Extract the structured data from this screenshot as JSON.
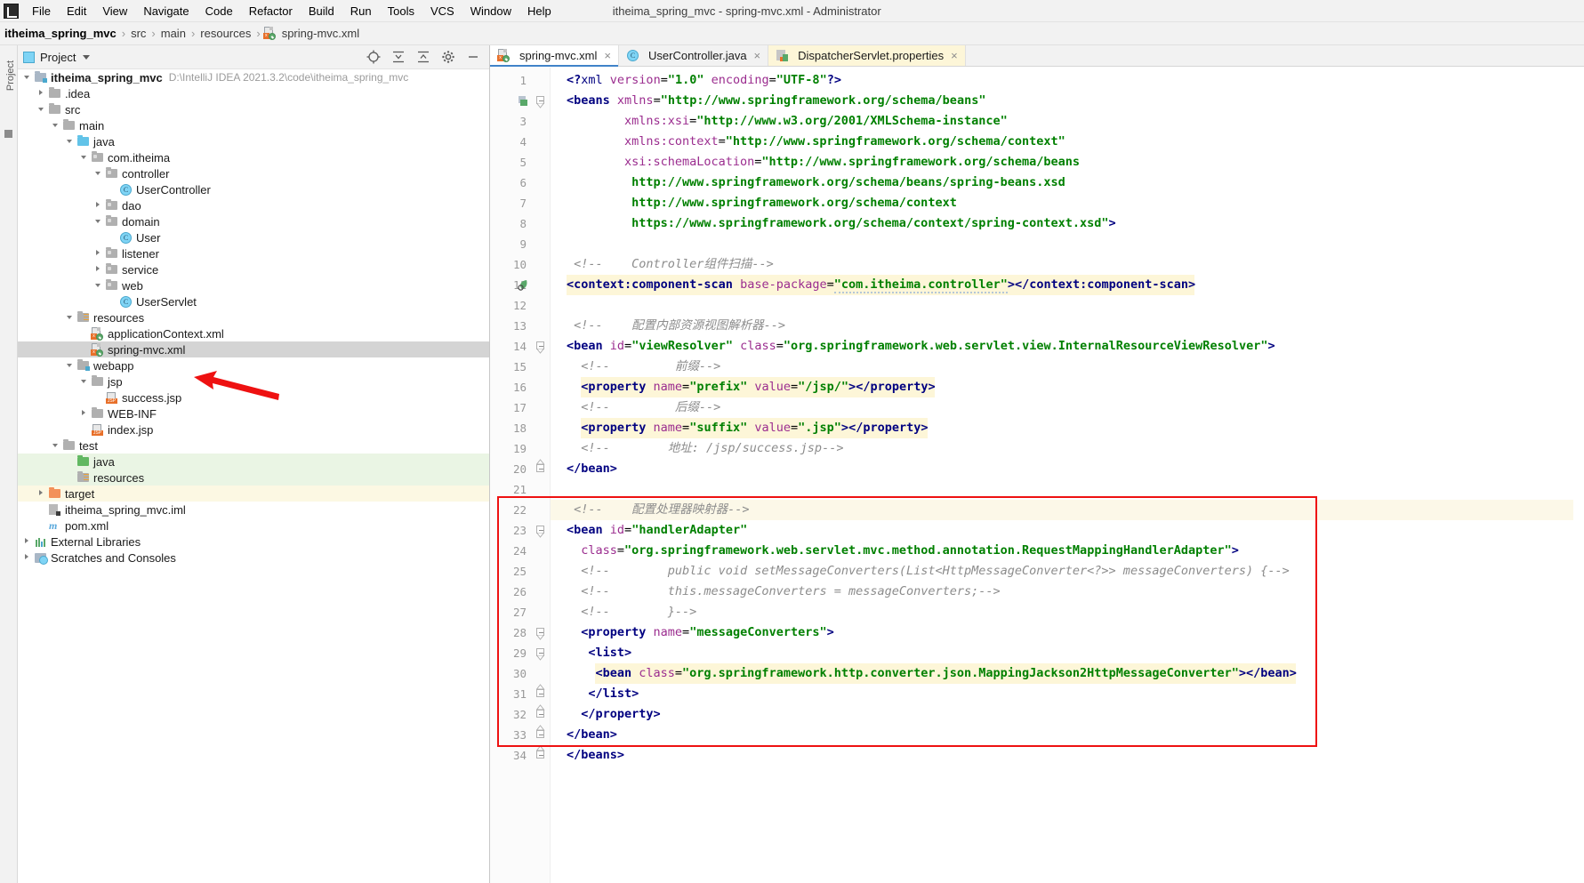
{
  "window": {
    "title": "itheima_spring_mvc - spring-mvc.xml - Administrator"
  },
  "menubar": {
    "items": [
      "File",
      "Edit",
      "View",
      "Navigate",
      "Code",
      "Refactor",
      "Build",
      "Run",
      "Tools",
      "VCS",
      "Window",
      "Help"
    ]
  },
  "breadcrumb": {
    "items": [
      "itheima_spring_mvc",
      "src",
      "main",
      "resources",
      "spring-mvc.xml"
    ],
    "separator": "›"
  },
  "toolstrip": {
    "project_label": "Project"
  },
  "project_panel": {
    "title": "Project",
    "tree": [
      {
        "depth": 0,
        "arrow": "down",
        "icon": "module-folder",
        "label": "itheima_spring_mvc",
        "bold": true,
        "path": "D:\\IntelliJ IDEA 2021.3.2\\code\\itheima_spring_mvc"
      },
      {
        "depth": 1,
        "arrow": "right",
        "icon": "folder-gray",
        "label": ".idea"
      },
      {
        "depth": 1,
        "arrow": "down",
        "icon": "folder-gray",
        "label": "src"
      },
      {
        "depth": 2,
        "arrow": "down",
        "icon": "folder-gray",
        "label": "main"
      },
      {
        "depth": 3,
        "arrow": "down",
        "icon": "folder-blue",
        "label": "java"
      },
      {
        "depth": 4,
        "arrow": "down",
        "icon": "package",
        "label": "com.itheima"
      },
      {
        "depth": 5,
        "arrow": "down",
        "icon": "package",
        "label": "controller"
      },
      {
        "depth": 6,
        "arrow": "none",
        "icon": "class",
        "label": "UserController"
      },
      {
        "depth": 5,
        "arrow": "right",
        "icon": "package",
        "label": "dao"
      },
      {
        "depth": 5,
        "arrow": "down",
        "icon": "package",
        "label": "domain"
      },
      {
        "depth": 6,
        "arrow": "none",
        "icon": "class",
        "label": "User"
      },
      {
        "depth": 5,
        "arrow": "right",
        "icon": "package",
        "label": "listener"
      },
      {
        "depth": 5,
        "arrow": "right",
        "icon": "package",
        "label": "service"
      },
      {
        "depth": 5,
        "arrow": "down",
        "icon": "package",
        "label": "web"
      },
      {
        "depth": 6,
        "arrow": "none",
        "icon": "class",
        "label": "UserServlet"
      },
      {
        "depth": 3,
        "arrow": "down",
        "icon": "folder-resources",
        "label": "resources"
      },
      {
        "depth": 4,
        "arrow": "none",
        "icon": "xml",
        "label": "applicationContext.xml"
      },
      {
        "depth": 4,
        "arrow": "none",
        "icon": "xml",
        "label": "spring-mvc.xml",
        "selected": true
      },
      {
        "depth": 3,
        "arrow": "down",
        "icon": "folder-webapp",
        "label": "webapp"
      },
      {
        "depth": 4,
        "arrow": "down",
        "icon": "folder-gray",
        "label": "jsp"
      },
      {
        "depth": 5,
        "arrow": "none",
        "icon": "jsp",
        "label": "success.jsp"
      },
      {
        "depth": 4,
        "arrow": "right",
        "icon": "folder-gray",
        "label": "WEB-INF"
      },
      {
        "depth": 4,
        "arrow": "none",
        "icon": "jsp",
        "label": "index.jsp"
      },
      {
        "depth": 2,
        "arrow": "down",
        "icon": "folder-gray",
        "label": "test"
      },
      {
        "depth": 3,
        "arrow": "none",
        "icon": "folder-green",
        "label": "java",
        "bg": "green"
      },
      {
        "depth": 3,
        "arrow": "none",
        "icon": "folder-test-resources",
        "label": "resources",
        "bg": "green"
      },
      {
        "depth": 1,
        "arrow": "right",
        "icon": "folder-orange",
        "label": "target",
        "bg": "yellow"
      },
      {
        "depth": 1,
        "arrow": "none",
        "icon": "iml",
        "label": "itheima_spring_mvc.iml"
      },
      {
        "depth": 1,
        "arrow": "none",
        "icon": "maven",
        "label": "pom.xml"
      },
      {
        "depth": 0,
        "arrow": "right",
        "icon": "libraries",
        "label": "External Libraries"
      },
      {
        "depth": 0,
        "arrow": "right",
        "icon": "scratches",
        "label": "Scratches and Consoles"
      }
    ]
  },
  "editor": {
    "tabs": [
      {
        "label": "spring-mvc.xml",
        "icon": "xml",
        "active": true,
        "closable": true
      },
      {
        "label": "UserController.java",
        "icon": "class",
        "active": false,
        "closable": true
      },
      {
        "label": "DispatcherServlet.properties",
        "icon": "properties",
        "active": false,
        "closable": true,
        "highlight": "yellow"
      }
    ],
    "highlight_box_color": "#ee1111",
    "lines": [
      {
        "n": 1,
        "indent": 0,
        "segments": [
          {
            "t": "<?",
            "c": "tag"
          },
          {
            "t": "xml",
            "c": "name"
          },
          {
            "t": " ",
            "c": "plain"
          },
          {
            "t": "version",
            "c": "attr"
          },
          {
            "t": "=",
            "c": "plain"
          },
          {
            "t": "\"1.0\"",
            "c": "str"
          },
          {
            "t": " ",
            "c": "plain"
          },
          {
            "t": "encoding",
            "c": "attr"
          },
          {
            "t": "=",
            "c": "plain"
          },
          {
            "t": "\"UTF-8\"",
            "c": "str"
          },
          {
            "t": "?>",
            "c": "tag"
          }
        ]
      },
      {
        "n": 2,
        "indent": 0,
        "fold": "start",
        "gmark": "xml-bean",
        "segments": [
          {
            "t": "<beans",
            "c": "tag"
          },
          {
            "t": " ",
            "c": "plain"
          },
          {
            "t": "xmlns",
            "c": "attr"
          },
          {
            "t": "=",
            "c": "plain"
          },
          {
            "t": "\"http://www.springframework.org/schema/beans\"",
            "c": "str"
          }
        ]
      },
      {
        "n": 3,
        "indent": 8,
        "segments": [
          {
            "t": "xmlns:xsi",
            "c": "attr"
          },
          {
            "t": "=",
            "c": "plain"
          },
          {
            "t": "\"http://www.w3.org/2001/XMLSchema-instance\"",
            "c": "str"
          }
        ]
      },
      {
        "n": 4,
        "indent": 8,
        "segments": [
          {
            "t": "xmlns:context",
            "c": "attr"
          },
          {
            "t": "=",
            "c": "plain"
          },
          {
            "t": "\"http://www.springframework.org/schema/context\"",
            "c": "str"
          }
        ]
      },
      {
        "n": 5,
        "indent": 8,
        "segments": [
          {
            "t": "xsi:schemaLocation",
            "c": "attr"
          },
          {
            "t": "=",
            "c": "plain"
          },
          {
            "t": "\"http://www.springframework.org/schema/beans",
            "c": "str"
          }
        ]
      },
      {
        "n": 6,
        "indent": 9,
        "segments": [
          {
            "t": "http://www.springframework.org/schema/beans/spring-beans.xsd",
            "c": "str"
          }
        ]
      },
      {
        "n": 7,
        "indent": 9,
        "segments": [
          {
            "t": "http://www.springframework.org/schema/context",
            "c": "str"
          }
        ]
      },
      {
        "n": 8,
        "indent": 9,
        "segments": [
          {
            "t": "https://www.springframework.org/schema/context/spring-context.xsd\"",
            "c": "str"
          },
          {
            "t": ">",
            "c": "tag"
          }
        ]
      },
      {
        "n": 9,
        "indent": 0,
        "segments": []
      },
      {
        "n": 10,
        "indent": 1,
        "segments": [
          {
            "t": "<!--    Controller组件扫描-->",
            "c": "comment"
          }
        ]
      },
      {
        "n": 11,
        "indent": 0,
        "gmark": "bean-nav",
        "hl": true,
        "segments": [
          {
            "t": "<context:component-scan",
            "c": "tag"
          },
          {
            "t": " ",
            "c": "plain"
          },
          {
            "t": "base-package",
            "c": "attr"
          },
          {
            "t": "=",
            "c": "plain"
          },
          {
            "t": "\"com.itheima.controller\"",
            "c": "str",
            "squiggle": true
          },
          {
            "t": ">",
            "c": "tag"
          },
          {
            "t": "</context:component-scan>",
            "c": "tag"
          }
        ]
      },
      {
        "n": 12,
        "indent": 0,
        "segments": []
      },
      {
        "n": 13,
        "indent": 1,
        "segments": [
          {
            "t": "<!--    配置内部资源视图解析器-->",
            "c": "comment"
          }
        ]
      },
      {
        "n": 14,
        "indent": 0,
        "fold": "start",
        "segments": [
          {
            "t": "<bean",
            "c": "tag"
          },
          {
            "t": " ",
            "c": "plain"
          },
          {
            "t": "id",
            "c": "attr"
          },
          {
            "t": "=",
            "c": "plain"
          },
          {
            "t": "\"viewResolver\"",
            "c": "str"
          },
          {
            "t": " ",
            "c": "plain"
          },
          {
            "t": "class",
            "c": "attr"
          },
          {
            "t": "=",
            "c": "plain"
          },
          {
            "t": "\"org.springframework.web.servlet.view.InternalResourceViewResolver\"",
            "c": "str"
          },
          {
            "t": ">",
            "c": "tag"
          }
        ]
      },
      {
        "n": 15,
        "indent": 2,
        "segments": [
          {
            "t": "<!--         前缀-->",
            "c": "comment"
          }
        ]
      },
      {
        "n": 16,
        "indent": 2,
        "hl": true,
        "segments": [
          {
            "t": "<property",
            "c": "tag"
          },
          {
            "t": " ",
            "c": "plain"
          },
          {
            "t": "name",
            "c": "attr"
          },
          {
            "t": "=",
            "c": "plain"
          },
          {
            "t": "\"prefix\"",
            "c": "str"
          },
          {
            "t": " ",
            "c": "plain"
          },
          {
            "t": "value",
            "c": "attr"
          },
          {
            "t": "=",
            "c": "plain"
          },
          {
            "t": "\"/jsp/\"",
            "c": "str"
          },
          {
            "t": ">",
            "c": "tag"
          },
          {
            "t": "</property>",
            "c": "tag"
          }
        ]
      },
      {
        "n": 17,
        "indent": 2,
        "segments": [
          {
            "t": "<!--         后缀-->",
            "c": "comment"
          }
        ]
      },
      {
        "n": 18,
        "indent": 2,
        "hl": true,
        "segments": [
          {
            "t": "<property",
            "c": "tag"
          },
          {
            "t": " ",
            "c": "plain"
          },
          {
            "t": "name",
            "c": "attr"
          },
          {
            "t": "=",
            "c": "plain"
          },
          {
            "t": "\"suffix\"",
            "c": "str"
          },
          {
            "t": " ",
            "c": "plain"
          },
          {
            "t": "value",
            "c": "attr"
          },
          {
            "t": "=",
            "c": "plain"
          },
          {
            "t": "\".jsp\"",
            "c": "str"
          },
          {
            "t": ">",
            "c": "tag"
          },
          {
            "t": "</property>",
            "c": "tag"
          }
        ]
      },
      {
        "n": 19,
        "indent": 2,
        "segments": [
          {
            "t": "<!--        地址: /jsp/success.jsp-->",
            "c": "comment"
          }
        ]
      },
      {
        "n": 20,
        "indent": 0,
        "fold": "end",
        "segments": [
          {
            "t": "</bean>",
            "c": "tag"
          }
        ]
      },
      {
        "n": 21,
        "indent": 0,
        "segments": []
      },
      {
        "n": 22,
        "indent": 1,
        "rowhl": true,
        "segments": [
          {
            "t": "<!--    配置处理器映射器-->",
            "c": "comment"
          }
        ]
      },
      {
        "n": 23,
        "indent": 0,
        "fold": "start",
        "segments": [
          {
            "t": "<bean",
            "c": "tag"
          },
          {
            "t": " ",
            "c": "plain"
          },
          {
            "t": "id",
            "c": "attr"
          },
          {
            "t": "=",
            "c": "plain"
          },
          {
            "t": "\"handlerAdapter\"",
            "c": "str"
          }
        ]
      },
      {
        "n": 24,
        "indent": 2,
        "segments": [
          {
            "t": "class",
            "c": "attr"
          },
          {
            "t": "=",
            "c": "plain"
          },
          {
            "t": "\"org.springframework.web.servlet.mvc.method.annotation.RequestMappingHandlerAdapter\"",
            "c": "str"
          },
          {
            "t": ">",
            "c": "tag"
          }
        ]
      },
      {
        "n": 25,
        "indent": 2,
        "segments": [
          {
            "t": "<!--        public void setMessageConverters(List<HttpMessageConverter<?>> messageConverters) {-->",
            "c": "comment"
          }
        ]
      },
      {
        "n": 26,
        "indent": 2,
        "segments": [
          {
            "t": "<!--        this.messageConverters = messageConverters;-->",
            "c": "comment"
          }
        ]
      },
      {
        "n": 27,
        "indent": 2,
        "segments": [
          {
            "t": "<!--        }-->",
            "c": "comment"
          }
        ]
      },
      {
        "n": 28,
        "indent": 2,
        "fold": "start",
        "segments": [
          {
            "t": "<property",
            "c": "tag"
          },
          {
            "t": " ",
            "c": "plain"
          },
          {
            "t": "name",
            "c": "attr"
          },
          {
            "t": "=",
            "c": "plain"
          },
          {
            "t": "\"messageConverters\"",
            "c": "str"
          },
          {
            "t": ">",
            "c": "tag"
          }
        ]
      },
      {
        "n": 29,
        "indent": 3,
        "fold": "start",
        "segments": [
          {
            "t": "<list>",
            "c": "tag"
          }
        ]
      },
      {
        "n": 30,
        "indent": 4,
        "hl": true,
        "segments": [
          {
            "t": "<bean",
            "c": "tag"
          },
          {
            "t": " ",
            "c": "plain"
          },
          {
            "t": "class",
            "c": "attr"
          },
          {
            "t": "=",
            "c": "plain"
          },
          {
            "t": "\"org.springframework.http.converter.json.MappingJackson2HttpMessageConverter\"",
            "c": "str"
          },
          {
            "t": ">",
            "c": "tag"
          },
          {
            "t": "</bean>",
            "c": "tag"
          }
        ]
      },
      {
        "n": 31,
        "indent": 3,
        "fold": "end",
        "segments": [
          {
            "t": "</list>",
            "c": "tag"
          }
        ]
      },
      {
        "n": 32,
        "indent": 2,
        "fold": "end",
        "segments": [
          {
            "t": "</property>",
            "c": "tag"
          }
        ]
      },
      {
        "n": 33,
        "indent": 0,
        "fold": "end",
        "segments": [
          {
            "t": "</bean>",
            "c": "tag"
          }
        ]
      },
      {
        "n": 34,
        "indent": 0,
        "fold": "end",
        "segments": [
          {
            "t": "</beans>",
            "c": "tag"
          }
        ]
      }
    ]
  },
  "colors": {
    "accent": "#4083c9",
    "annotation_red": "#ee1111",
    "selection_gray": "#d4d4d4",
    "test_source_green": "#eaf5e4",
    "excluded_yellow": "#fcf8e3",
    "string_green": "#008000",
    "tag_navy": "#000080",
    "attr_purple": "#9b2d8f",
    "comment_gray": "#8c8c8c"
  }
}
